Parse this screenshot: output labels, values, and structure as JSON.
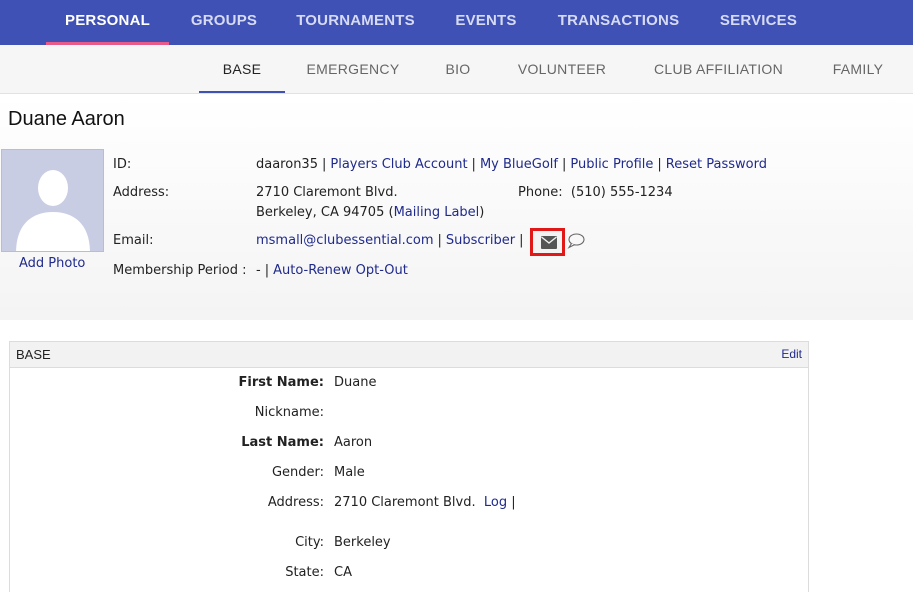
{
  "top_nav": {
    "tabs": [
      {
        "label": "PERSONAL",
        "active": true
      },
      {
        "label": "GROUPS",
        "active": false
      },
      {
        "label": "TOURNAMENTS",
        "active": false
      },
      {
        "label": "EVENTS",
        "active": false
      },
      {
        "label": "TRANSACTIONS",
        "active": false
      },
      {
        "label": "SERVICES",
        "active": false
      }
    ]
  },
  "sub_nav": {
    "tabs": [
      {
        "label": "BASE",
        "active": true
      },
      {
        "label": "EMERGENCY",
        "active": false
      },
      {
        "label": "BIO",
        "active": false
      },
      {
        "label": "VOLUNTEER",
        "active": false
      },
      {
        "label": "CLUB AFFILIATION",
        "active": false
      },
      {
        "label": "FAMILY",
        "active": false
      }
    ]
  },
  "profile": {
    "name": "Duane Aaron",
    "add_photo": "Add Photo",
    "id_label": "ID:",
    "id_value": "daaron35",
    "id_links": [
      "Players Club Account",
      "My BlueGolf",
      "Public Profile",
      "Reset Password"
    ],
    "address_label": "Address:",
    "address_line1": "2710 Claremont Blvd.",
    "address_line2": "Berkeley, CA 94705",
    "mailing_label": "Mailing Label",
    "phone_label": "Phone:",
    "phone_value": "(510) 555-1234",
    "email_label": "Email:",
    "email_value": "msmall@clubessential.com",
    "subscriber": "Subscriber",
    "membership_label": "Membership Period :",
    "membership_value": "-",
    "auto_renew": "Auto-Renew Opt-Out",
    "icons": {
      "message": "envelope-icon",
      "chat": "speech-bubble-icon"
    }
  },
  "base_panel": {
    "title": "BASE",
    "edit": "Edit",
    "fields": [
      {
        "label": "First Name:",
        "value": "Duane",
        "bold": true
      },
      {
        "label": "Nickname:",
        "value": "",
        "bold": false
      },
      {
        "label": "Last Name:",
        "value": "Aaron",
        "bold": true
      },
      {
        "label": "Gender:",
        "value": "Male",
        "bold": false
      },
      {
        "label": "Address:",
        "value": "2710 Claremont Blvd.",
        "bold": false
      },
      {
        "label": "City:",
        "value": "Berkeley",
        "bold": false
      },
      {
        "label": "State:",
        "value": "CA",
        "bold": false
      }
    ],
    "address_log": "Log"
  },
  "colors": {
    "nav_bg": "#3f51b5",
    "active_underline": "#e85a8a",
    "link": "#1f2a8c",
    "highlight": "#e01818"
  }
}
